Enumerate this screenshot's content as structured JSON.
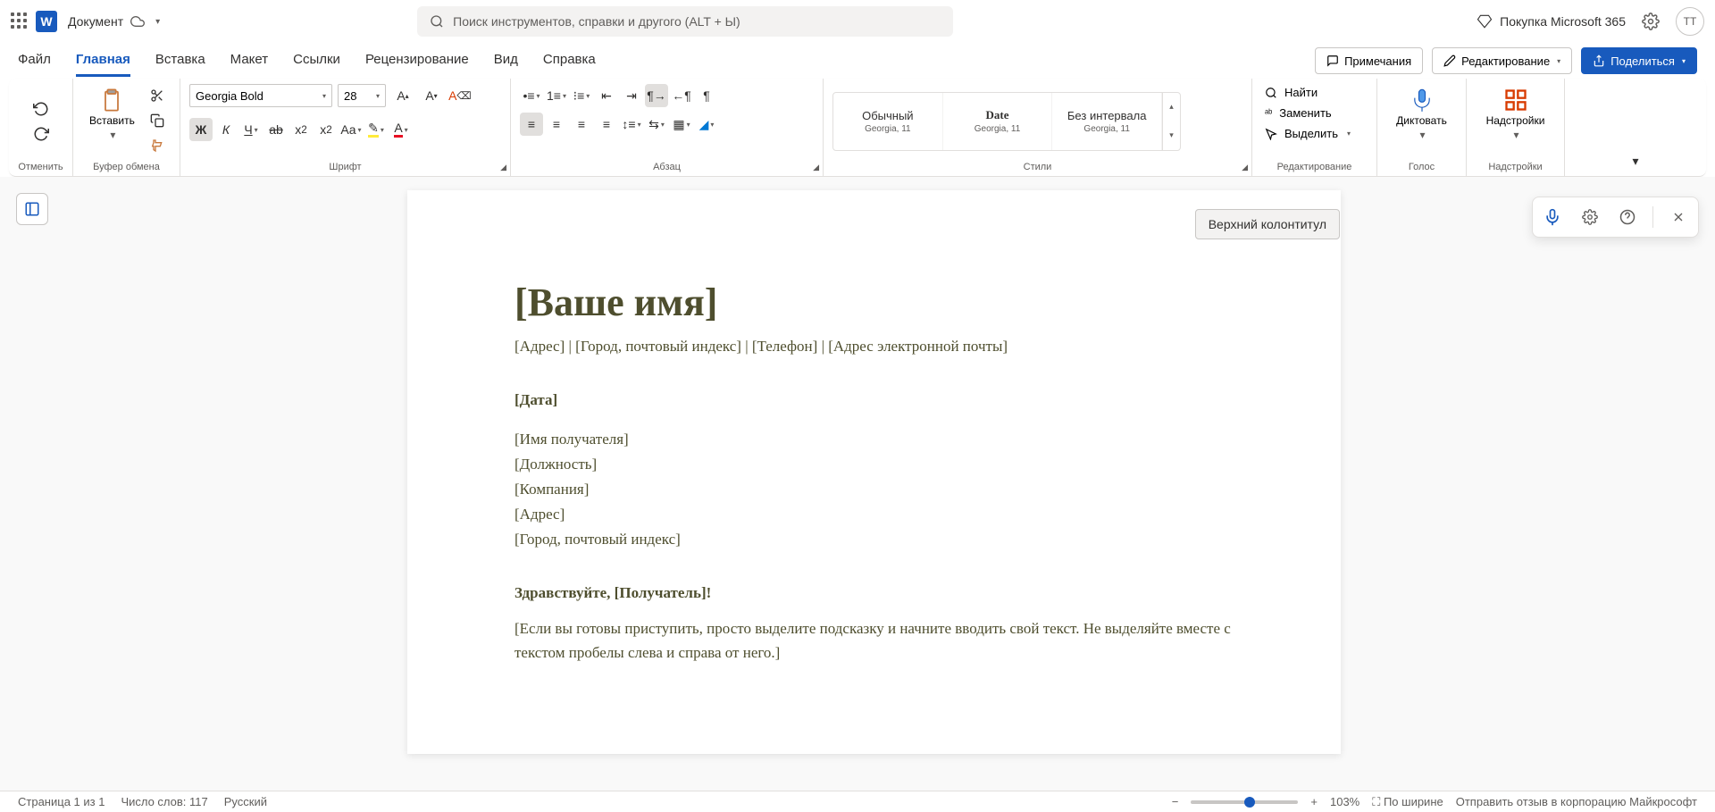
{
  "title_bar": {
    "doc_name": "Документ",
    "search_placeholder": "Поиск инструментов, справки и другого (ALT + Ы)",
    "buy_label": "Покупка Microsoft 365",
    "avatar": "TT"
  },
  "tabs": {
    "items": [
      "Файл",
      "Главная",
      "Вставка",
      "Макет",
      "Ссылки",
      "Рецензирование",
      "Вид",
      "Справка"
    ],
    "active_index": 1,
    "comments": "Примечания",
    "editing": "Редактирование",
    "share": "Поделиться"
  },
  "ribbon": {
    "undo_label": "Отменить",
    "clipboard": {
      "paste": "Вставить",
      "label": "Буфер обмена"
    },
    "font": {
      "name": "Georgia Bold",
      "size": "28",
      "label": "Шрифт"
    },
    "paragraph": {
      "label": "Абзац"
    },
    "styles": {
      "label": "Стили",
      "items": [
        {
          "name": "Обычный",
          "sub": "Georgia, 11"
        },
        {
          "name": "Date",
          "sub": "Georgia, 11"
        },
        {
          "name": "Без интервала",
          "sub": "Georgia, 11"
        }
      ]
    },
    "editing": {
      "find": "Найти",
      "replace": "Заменить",
      "select": "Выделить",
      "label": "Редактирование"
    },
    "voice": {
      "dictate": "Диктовать",
      "label": "Голос"
    },
    "addins": {
      "button": "Надстройки",
      "label": "Надстройки"
    }
  },
  "document": {
    "title": "[Ваше имя]",
    "contact": "[Адрес] | [Город, почтовый индекс] | [Телефон] | [Адрес электронной почты]",
    "date": "[Дата]",
    "recipient_name": "[Имя получателя]",
    "recipient_title": "[Должность]",
    "recipient_company": "[Компания]",
    "recipient_address": "[Адрес]",
    "recipient_city": "[Город, почтовый индекс]",
    "greeting": "Здравствуйте, [Получатель]!",
    "body": "[Если вы готовы приступить, просто выделите подсказку и начните вводить свой текст. Не выделяйте вместе с текстом пробелы слева и справа от него.]",
    "header_tag": "Верхний колонтитул"
  },
  "status": {
    "page": "Страница 1 из 1",
    "words": "Число слов: 117",
    "lang": "Русский",
    "zoom": "103%",
    "fit": "По ширине",
    "feedback": "Отправить отзыв в корпорацию Майкрософт"
  }
}
